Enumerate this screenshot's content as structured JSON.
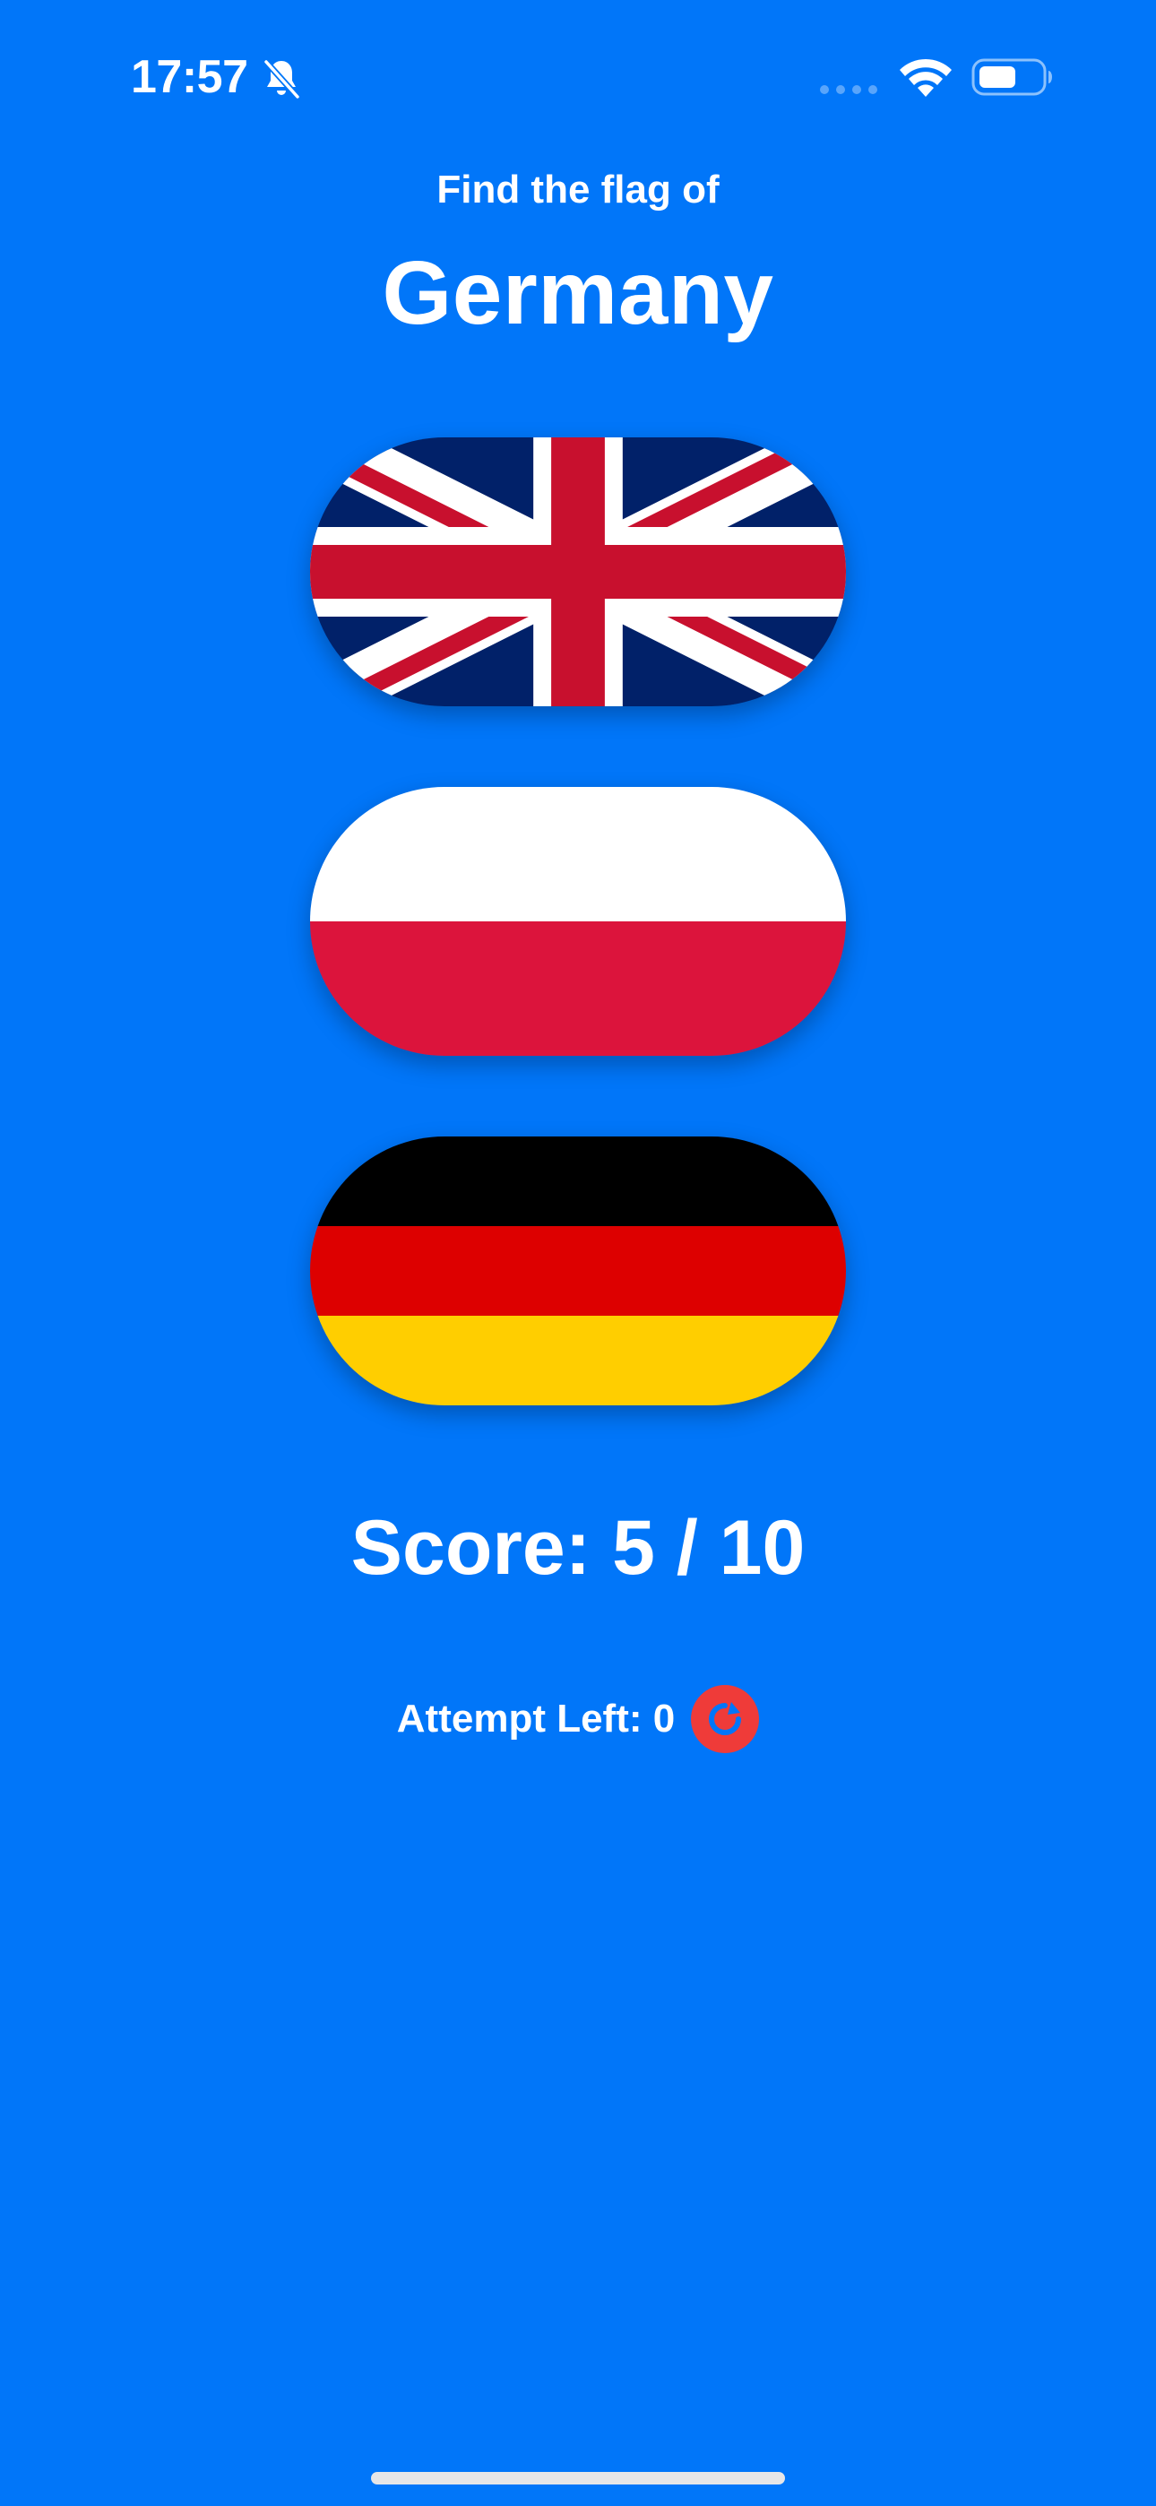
{
  "status_bar": {
    "time": "17:57",
    "icons": [
      "bell-slash-icon",
      "cellular-signal-icon",
      "wifi-icon",
      "battery-icon"
    ]
  },
  "game": {
    "prompt": "Find the flag of",
    "country": "Germany",
    "options": [
      {
        "flag": "united-kingdom-flag"
      },
      {
        "flag": "poland-flag"
      },
      {
        "flag": "germany-flag"
      }
    ],
    "score_text": "Score: 5 / 10",
    "attempts_text": "Attempt Left: 0",
    "reset_icon": "reset-icon"
  },
  "colors": {
    "background": "#0176F9",
    "text": "#FFFFFF",
    "reset_button": "#EF3B39",
    "home_indicator": "#E6E6E8"
  }
}
